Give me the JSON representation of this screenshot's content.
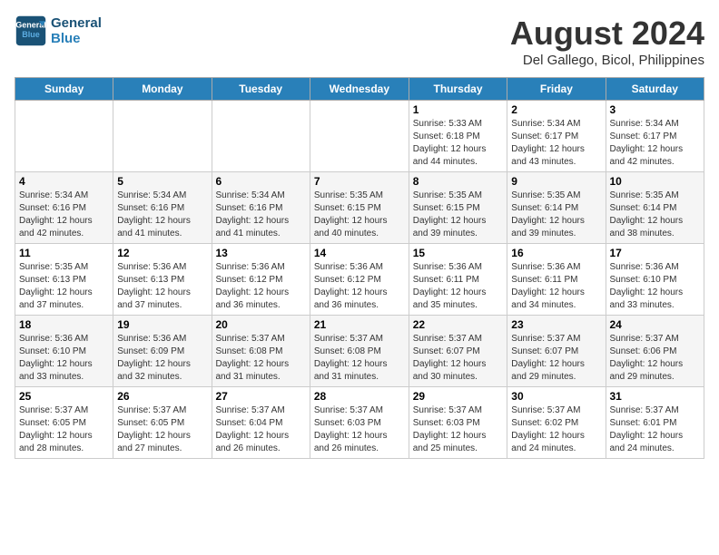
{
  "logo": {
    "line1": "General",
    "line2": "Blue"
  },
  "title": "August 2024",
  "location": "Del Gallego, Bicol, Philippines",
  "days_header": [
    "Sunday",
    "Monday",
    "Tuesday",
    "Wednesday",
    "Thursday",
    "Friday",
    "Saturday"
  ],
  "weeks": [
    [
      {
        "day": "",
        "info": ""
      },
      {
        "day": "",
        "info": ""
      },
      {
        "day": "",
        "info": ""
      },
      {
        "day": "",
        "info": ""
      },
      {
        "day": "1",
        "info": "Sunrise: 5:33 AM\nSunset: 6:18 PM\nDaylight: 12 hours\nand 44 minutes."
      },
      {
        "day": "2",
        "info": "Sunrise: 5:34 AM\nSunset: 6:17 PM\nDaylight: 12 hours\nand 43 minutes."
      },
      {
        "day": "3",
        "info": "Sunrise: 5:34 AM\nSunset: 6:17 PM\nDaylight: 12 hours\nand 42 minutes."
      }
    ],
    [
      {
        "day": "4",
        "info": "Sunrise: 5:34 AM\nSunset: 6:16 PM\nDaylight: 12 hours\nand 42 minutes."
      },
      {
        "day": "5",
        "info": "Sunrise: 5:34 AM\nSunset: 6:16 PM\nDaylight: 12 hours\nand 41 minutes."
      },
      {
        "day": "6",
        "info": "Sunrise: 5:34 AM\nSunset: 6:16 PM\nDaylight: 12 hours\nand 41 minutes."
      },
      {
        "day": "7",
        "info": "Sunrise: 5:35 AM\nSunset: 6:15 PM\nDaylight: 12 hours\nand 40 minutes."
      },
      {
        "day": "8",
        "info": "Sunrise: 5:35 AM\nSunset: 6:15 PM\nDaylight: 12 hours\nand 39 minutes."
      },
      {
        "day": "9",
        "info": "Sunrise: 5:35 AM\nSunset: 6:14 PM\nDaylight: 12 hours\nand 39 minutes."
      },
      {
        "day": "10",
        "info": "Sunrise: 5:35 AM\nSunset: 6:14 PM\nDaylight: 12 hours\nand 38 minutes."
      }
    ],
    [
      {
        "day": "11",
        "info": "Sunrise: 5:35 AM\nSunset: 6:13 PM\nDaylight: 12 hours\nand 37 minutes."
      },
      {
        "day": "12",
        "info": "Sunrise: 5:36 AM\nSunset: 6:13 PM\nDaylight: 12 hours\nand 37 minutes."
      },
      {
        "day": "13",
        "info": "Sunrise: 5:36 AM\nSunset: 6:12 PM\nDaylight: 12 hours\nand 36 minutes."
      },
      {
        "day": "14",
        "info": "Sunrise: 5:36 AM\nSunset: 6:12 PM\nDaylight: 12 hours\nand 36 minutes."
      },
      {
        "day": "15",
        "info": "Sunrise: 5:36 AM\nSunset: 6:11 PM\nDaylight: 12 hours\nand 35 minutes."
      },
      {
        "day": "16",
        "info": "Sunrise: 5:36 AM\nSunset: 6:11 PM\nDaylight: 12 hours\nand 34 minutes."
      },
      {
        "day": "17",
        "info": "Sunrise: 5:36 AM\nSunset: 6:10 PM\nDaylight: 12 hours\nand 33 minutes."
      }
    ],
    [
      {
        "day": "18",
        "info": "Sunrise: 5:36 AM\nSunset: 6:10 PM\nDaylight: 12 hours\nand 33 minutes."
      },
      {
        "day": "19",
        "info": "Sunrise: 5:36 AM\nSunset: 6:09 PM\nDaylight: 12 hours\nand 32 minutes."
      },
      {
        "day": "20",
        "info": "Sunrise: 5:37 AM\nSunset: 6:08 PM\nDaylight: 12 hours\nand 31 minutes."
      },
      {
        "day": "21",
        "info": "Sunrise: 5:37 AM\nSunset: 6:08 PM\nDaylight: 12 hours\nand 31 minutes."
      },
      {
        "day": "22",
        "info": "Sunrise: 5:37 AM\nSunset: 6:07 PM\nDaylight: 12 hours\nand 30 minutes."
      },
      {
        "day": "23",
        "info": "Sunrise: 5:37 AM\nSunset: 6:07 PM\nDaylight: 12 hours\nand 29 minutes."
      },
      {
        "day": "24",
        "info": "Sunrise: 5:37 AM\nSunset: 6:06 PM\nDaylight: 12 hours\nand 29 minutes."
      }
    ],
    [
      {
        "day": "25",
        "info": "Sunrise: 5:37 AM\nSunset: 6:05 PM\nDaylight: 12 hours\nand 28 minutes."
      },
      {
        "day": "26",
        "info": "Sunrise: 5:37 AM\nSunset: 6:05 PM\nDaylight: 12 hours\nand 27 minutes."
      },
      {
        "day": "27",
        "info": "Sunrise: 5:37 AM\nSunset: 6:04 PM\nDaylight: 12 hours\nand 26 minutes."
      },
      {
        "day": "28",
        "info": "Sunrise: 5:37 AM\nSunset: 6:03 PM\nDaylight: 12 hours\nand 26 minutes."
      },
      {
        "day": "29",
        "info": "Sunrise: 5:37 AM\nSunset: 6:03 PM\nDaylight: 12 hours\nand 25 minutes."
      },
      {
        "day": "30",
        "info": "Sunrise: 5:37 AM\nSunset: 6:02 PM\nDaylight: 12 hours\nand 24 minutes."
      },
      {
        "day": "31",
        "info": "Sunrise: 5:37 AM\nSunset: 6:01 PM\nDaylight: 12 hours\nand 24 minutes."
      }
    ]
  ]
}
